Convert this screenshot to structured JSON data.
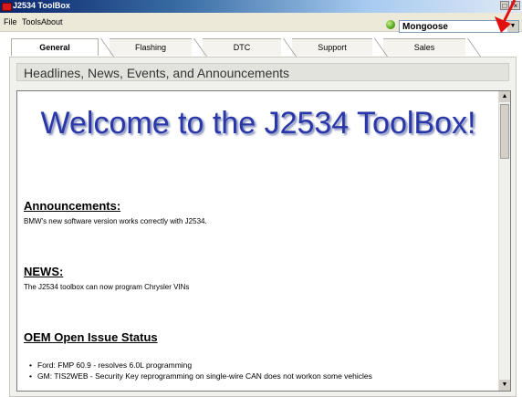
{
  "window": {
    "title": "J2534 ToolBox",
    "min": "_",
    "max": "□",
    "close": "×"
  },
  "menu": {
    "items": [
      "File",
      "Tools",
      "About"
    ]
  },
  "device_select": {
    "value": "Mongoose",
    "arrow": "▼"
  },
  "tabs": [
    "General",
    "Flashing",
    "DTC",
    "Support",
    "Sales"
  ],
  "headline": "Headlines, News, Events, and Announcements",
  "content": {
    "welcome": "Welcome to the J2534 ToolBox!",
    "announcements_heading": "Announcements:",
    "announcements_text": "BMW's new software version works correctly with J2534.",
    "news_heading": "NEWS:",
    "news_text": "The J2534 toolbox can now program Chrysler VINs",
    "oem_heading": "OEM Open Issue Status",
    "oem_items": [
      "Ford: FMP 60.9 - resolves 6.0L programming",
      "GM: TIS2WEB - Security Key reprogramming on single-wire CAN does not workon some vehicles"
    ]
  },
  "scrollbar": {
    "up": "▲",
    "down": "▼"
  },
  "colors": {
    "welcome_text": "#2a37a8",
    "annotation_arrow": "#e01010"
  }
}
